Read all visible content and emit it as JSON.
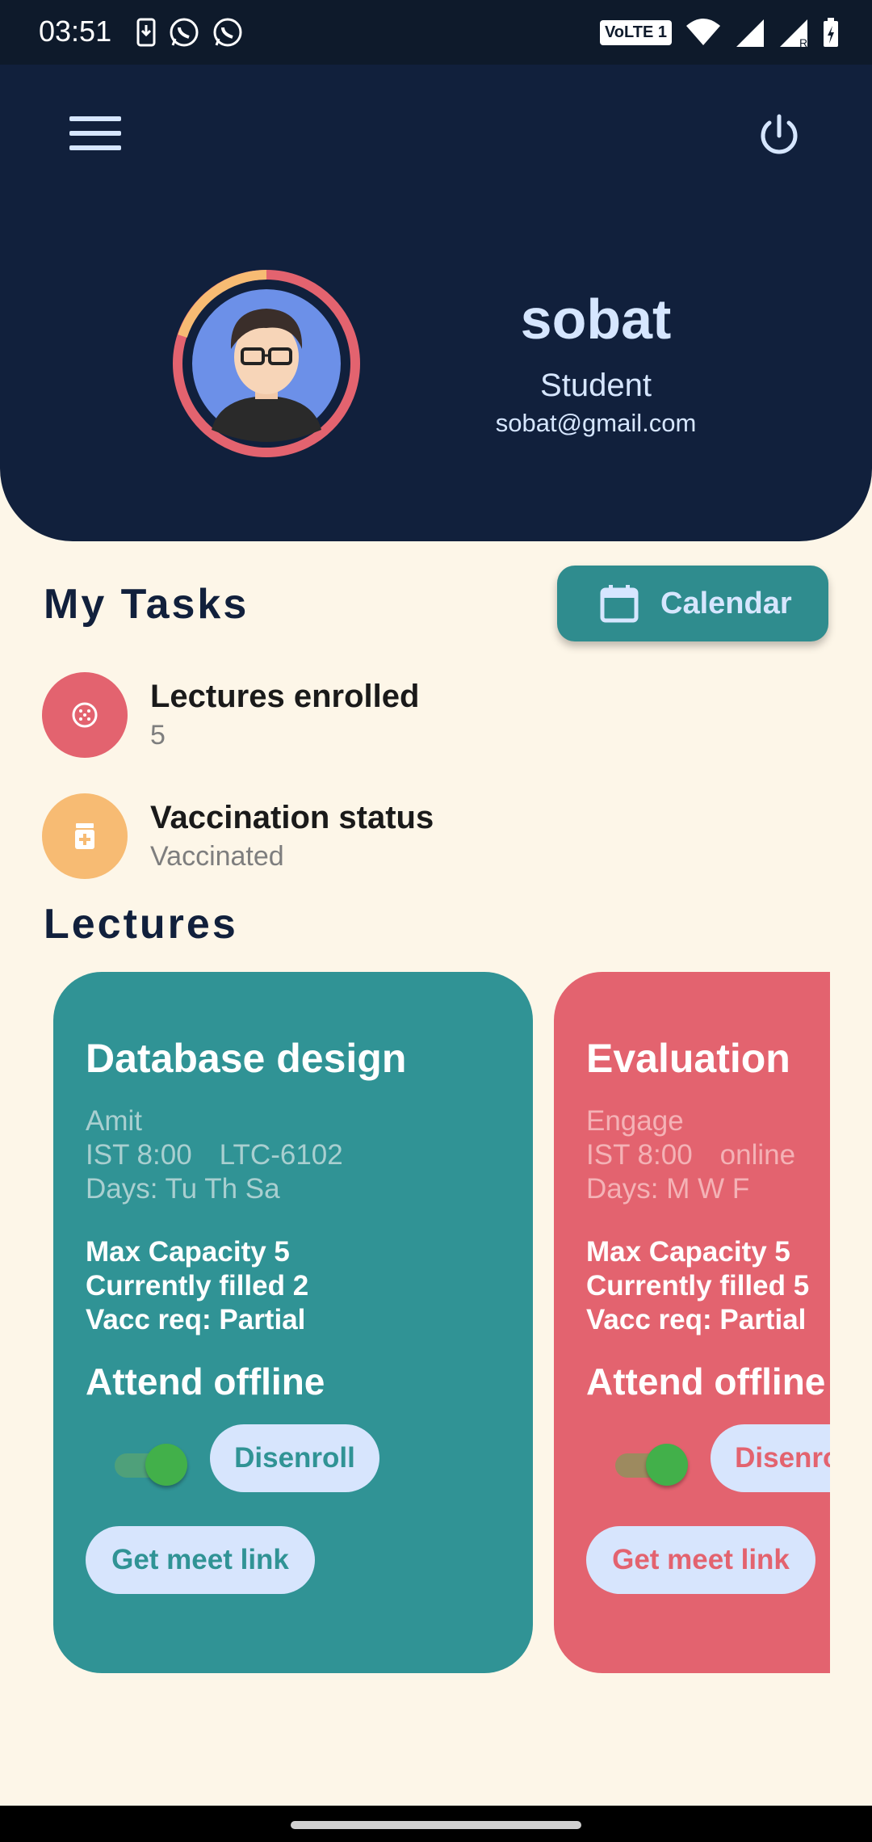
{
  "status_bar": {
    "time": "03:51",
    "left_icons": [
      "download-icon",
      "whatsapp-icon",
      "whatsapp-icon"
    ],
    "volte_label": "VoLTE 1",
    "right_icons": [
      "wifi-icon",
      "signal-icon",
      "signal-roaming-icon",
      "battery-charging-icon"
    ]
  },
  "header": {
    "menu_icon": "hamburger-menu-icon",
    "power_icon": "power-icon",
    "avatar": "avatar-icon",
    "name": "sobat",
    "role": "Student",
    "email": "sobat@gmail.com"
  },
  "tasks": {
    "title": "My Tasks",
    "calendar_label": "Calendar",
    "items": [
      {
        "icon": "lectures-icon",
        "label": "Lectures enrolled",
        "value": "5",
        "color": "#E3636F"
      },
      {
        "icon": "vaccine-icon",
        "label": "Vaccination status",
        "value": "Vaccinated",
        "color": "#F7BB73"
      }
    ]
  },
  "lectures": {
    "title": "Lectures",
    "cards": [
      {
        "title": "Database design",
        "teacher": "Amit",
        "time": "IST 8:00",
        "location": "LTC-6102",
        "days": "Days: Tu Th Sa",
        "max_capacity": "Max Capacity  5",
        "currently_filled": "Currently filled  2",
        "vacc_req": "Vacc req:  Partial",
        "attend_label": "Attend offline",
        "attend_offline_on": true,
        "disenroll_label": "Disenroll",
        "meet_label": "Get meet link",
        "bg_color": "#309395",
        "muted_color": "#A9CFD0",
        "track_color": "#4FA07A"
      },
      {
        "title": "Evaluation",
        "teacher": "Engage",
        "time": "IST 8:00",
        "location": "online",
        "days": "Days: M W F",
        "max_capacity": "Max Capacity  5",
        "currently_filled": "Currently filled  5",
        "vacc_req": "Vacc req:  Partial",
        "attend_label": "Attend offline",
        "attend_offline_on": true,
        "disenroll_label": "Disenroll",
        "meet_label": "Get meet link",
        "bg_color": "#E3636F",
        "muted_color": "#F4B2B6",
        "track_color": "#9D8A5F"
      }
    ]
  },
  "colors": {
    "header_bg": "#11203C",
    "page_bg": "#FDF6E8",
    "accent_teal": "#309395",
    "accent_red": "#E3636F",
    "accent_orange": "#F7BB73",
    "text_light_blue": "#D6E6FF"
  }
}
